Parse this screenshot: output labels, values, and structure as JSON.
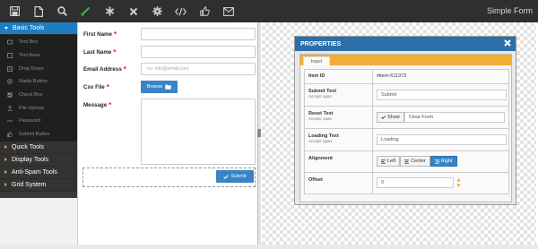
{
  "app": {
    "title": "Simple Form"
  },
  "toolbar": {
    "icons": [
      "save-icon",
      "new-file-icon",
      "search-icon",
      "brush-icon",
      "asterisk-icon",
      "close-icon",
      "gear-icon",
      "code-icon",
      "thumbs-up-icon",
      "envelope-icon"
    ],
    "brush_color": "#35b34a"
  },
  "sidebar": {
    "basic_tools": "Basic Tools",
    "items": [
      {
        "label": "Text Box",
        "icon": "textbox-icon"
      },
      {
        "label": "Text Area",
        "icon": "textarea-icon"
      },
      {
        "label": "Drop Down",
        "icon": "dropdown-icon"
      },
      {
        "label": "Radio Button",
        "icon": "radio-icon"
      },
      {
        "label": "Check Box",
        "icon": "checkbox-icon"
      },
      {
        "label": "File Upload",
        "icon": "upload-icon"
      },
      {
        "label": "Password",
        "icon": "password-icon"
      },
      {
        "label": "Submit Button",
        "icon": "thumbs-up-icon"
      }
    ],
    "groups": [
      "Quick Tools",
      "Display Tools",
      "Anti-Spam Tools",
      "Grid System"
    ],
    "accent": "#1e7dc0"
  },
  "form": {
    "first_name": "First Name",
    "last_name": "Last Name",
    "email": "Email Address",
    "email_placeholder": "ex: info@email.com",
    "csv": "Csv File",
    "browse": "Browse",
    "message": "Message",
    "submit": "Submit",
    "required_mark": "*"
  },
  "properties": {
    "title": "PROPERTIES",
    "tab": "Input",
    "rows": {
      "item_id": {
        "label": "Item ID",
        "value": "#item-611373"
      },
      "submit_text": {
        "label": "Submit Text",
        "sub": "Accept: span",
        "value": "Submit"
      },
      "reset_text": {
        "label": "Reset Text",
        "sub": "Accept: span",
        "toggle": "Show",
        "value": "Clear Form"
      },
      "loading_text": {
        "label": "Loading Text",
        "sub": "Accept: span",
        "value": "Loading"
      },
      "alignment": {
        "label": "Alignment",
        "options": [
          "Left",
          "Center",
          "Right"
        ],
        "selected": "Right"
      },
      "offset": {
        "label": "Offset",
        "value": "0"
      }
    },
    "header_color": "#2b6fa8",
    "tab_color": "#f2ae37"
  }
}
